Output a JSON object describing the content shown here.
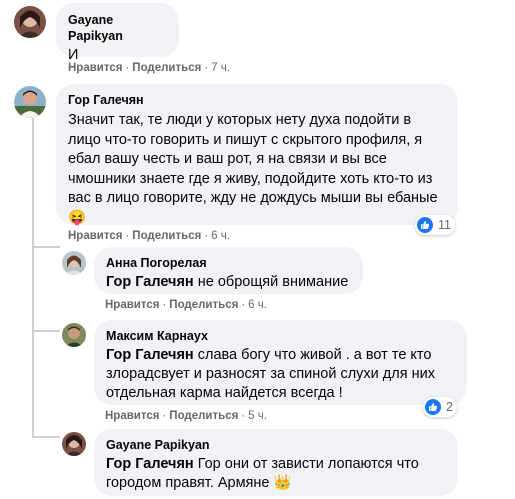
{
  "ui": {
    "like_label": "Нравится",
    "reply_label": "Поделиться"
  },
  "comments": [
    {
      "author": "Gayane Papikyan",
      "text": "И",
      "time": "7 ч."
    },
    {
      "author": "Гор Галечян",
      "text": "Значит так, те люди у которых нету духа подойти в лицо что-то говорить и пишут с скрытого профиля, я ебал вашу честь и ваш рот, я на связи и вы все чмошники знаете где я живу, подойдите хоть кто-то из вас в лицо говорите, жду не дождусь мыши вы ебаные",
      "emoji": "😝",
      "time": "6 ч.",
      "reactions": "11"
    }
  ],
  "replies": [
    {
      "author": "Анна Погорелая",
      "mention": "Гор Галечян",
      "text": "не оброщяй внимание",
      "time": "6 ч."
    },
    {
      "author": "Максим Карнаух",
      "mention": "Гор Галечян",
      "text": "слава богу что живой . а вот те кто злорадсвует и разносят за спиной слухи для них отдельная карма найдется всегда !",
      "time": "5 ч.",
      "reactions": "2"
    },
    {
      "author": "Gayane Papikyan",
      "mention": "Гор Галечян",
      "text": "Гор они от зависти лопаются что городом правят. Армяне",
      "emoji": "👑"
    }
  ],
  "colors": {
    "bubble": "#f0f2f5",
    "meta": "#65676b",
    "like_blue": "#1877f2",
    "thread_line": "#ced0d4"
  }
}
